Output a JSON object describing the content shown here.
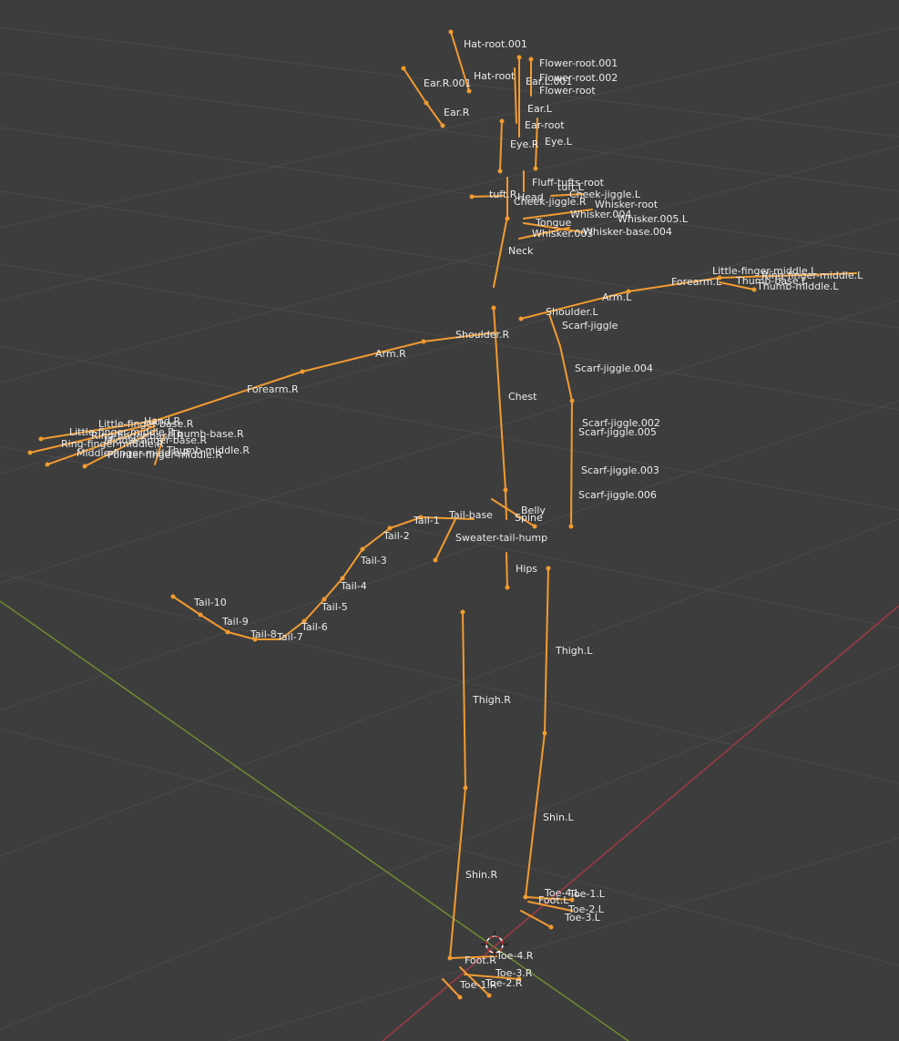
{
  "viewport": {
    "background": "#3d3d3d",
    "grid_color": "#4a4a4a",
    "bone_color": "#f29b30",
    "label_color": "#ececec",
    "axis_y_color": "#6d8c2f",
    "axis_x_color": "#a03a45",
    "cursor_colors": [
      "#ffffff",
      "#d33a3a"
    ]
  },
  "bones": [
    {
      "name": "Hat-root.001"
    },
    {
      "name": "Hat-root"
    },
    {
      "name": "Ear.R.001"
    },
    {
      "name": "Ear.R"
    },
    {
      "name": "Ear.L.001"
    },
    {
      "name": "Ear.L"
    },
    {
      "name": "Ear-root"
    },
    {
      "name": "Eye.R"
    },
    {
      "name": "Eye.L"
    },
    {
      "name": "Flower-root.001"
    },
    {
      "name": "Flower-root.002"
    },
    {
      "name": "Flower-root"
    },
    {
      "name": "Fluff-tufts-root"
    },
    {
      "name": "tuft.L"
    },
    {
      "name": "tuft.R"
    },
    {
      "name": "Head"
    },
    {
      "name": "Cheek-jiggle.L"
    },
    {
      "name": "Cheek-jiggle.R"
    },
    {
      "name": "Whisker-root"
    },
    {
      "name": "Whisker.004"
    },
    {
      "name": "Whisker.005.L"
    },
    {
      "name": "Whisker.003"
    },
    {
      "name": "Whisker-base.004"
    },
    {
      "name": "Tongue"
    },
    {
      "name": "Neck"
    },
    {
      "name": "Shoulder.L"
    },
    {
      "name": "Arm.L"
    },
    {
      "name": "Forearm.L"
    },
    {
      "name": "Thumb-middle.L"
    },
    {
      "name": "Little-finger-middle.L"
    },
    {
      "name": "Ring-finger-middle.L"
    },
    {
      "name": "Thumb-base.L"
    },
    {
      "name": "Shoulder.R"
    },
    {
      "name": "Arm.R"
    },
    {
      "name": "Forearm.R"
    },
    {
      "name": "Hand.R"
    },
    {
      "name": "Little-finger-base.R"
    },
    {
      "name": "Little-finger-middle.R"
    },
    {
      "name": "Ring-finger-base.R"
    },
    {
      "name": "Thumb-base.R"
    },
    {
      "name": "Middle-finger-base.R"
    },
    {
      "name": "Ring-finger-middle.R"
    },
    {
      "name": "Middle-finger-middle.R"
    },
    {
      "name": "Thumb-middle.R"
    },
    {
      "name": "Pointer-finger-middle.R"
    },
    {
      "name": "Scarf-jiggle"
    },
    {
      "name": "Scarf-jiggle.004"
    },
    {
      "name": "Scarf-jiggle.002"
    },
    {
      "name": "Scarf-jiggle.005"
    },
    {
      "name": "Scarf-jiggle.003"
    },
    {
      "name": "Scarf-jiggle.006"
    },
    {
      "name": "Chest"
    },
    {
      "name": "Belly"
    },
    {
      "name": "Spine"
    },
    {
      "name": "Tail-base"
    },
    {
      "name": "Sweater-tail-hump"
    },
    {
      "name": "Hips"
    },
    {
      "name": "Tail-1"
    },
    {
      "name": "Tail-2"
    },
    {
      "name": "Tail-3"
    },
    {
      "name": "Tail-4"
    },
    {
      "name": "Tail-5"
    },
    {
      "name": "Tail-6"
    },
    {
      "name": "Tail-7"
    },
    {
      "name": "Tail-8"
    },
    {
      "name": "Tail-9"
    },
    {
      "name": "Tail-10"
    },
    {
      "name": "Thigh.L"
    },
    {
      "name": "Shin.L"
    },
    {
      "name": "Foot.L"
    },
    {
      "name": "Toe-1.L"
    },
    {
      "name": "Toe-2.L"
    },
    {
      "name": "Toe-3.L"
    },
    {
      "name": "Toe-4.L"
    },
    {
      "name": "Thigh.R"
    },
    {
      "name": "Shin.R"
    },
    {
      "name": "Foot.R"
    },
    {
      "name": "Toe-1.R"
    },
    {
      "name": "Toe-2.R"
    },
    {
      "name": "Toe-3.R"
    },
    {
      "name": "Toe-4.R"
    }
  ]
}
